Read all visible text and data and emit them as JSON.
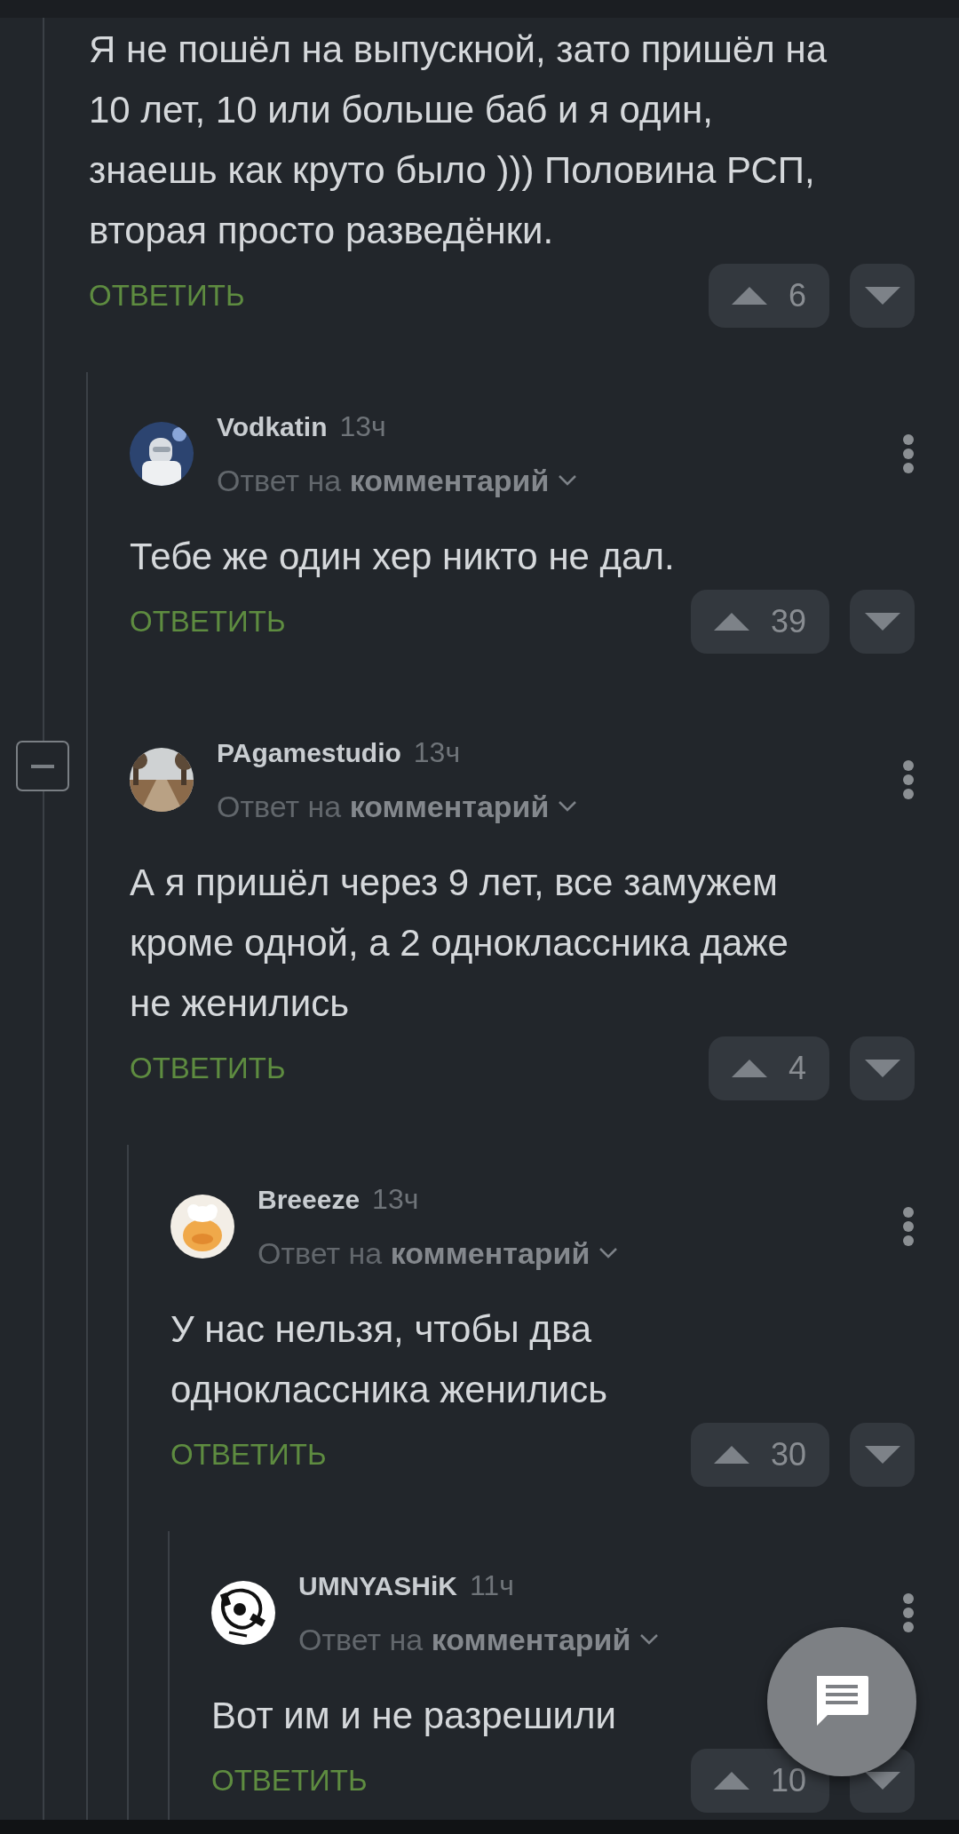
{
  "comments": [
    {
      "text": "Я не пошёл на выпускной, зато пришёл на 10 лет, 10 или больше баб и я один, знаешь как круто было ))) Половина РСП, вторая просто разведёнки.",
      "reply_label": "ОТВЕТИТЬ",
      "votes": "6",
      "replies": [
        {
          "author": "Vodkatin",
          "time": "13ч",
          "reply_to": "Ответ на **комментарий**",
          "text": "Тебе же один хер никто не дал.",
          "reply_label": "ОТВЕТИТЬ",
          "votes": "39"
        },
        {
          "author": "PAgamestudio",
          "time": "13ч",
          "reply_to": "Ответ на **комментарий**",
          "collapse": {
            "expanded": true
          },
          "text": "А я пришёл через 9 лет, все замужем кроме одной, а 2 одноклассника даже не женились",
          "reply_label": "ОТВЕТИТЬ",
          "votes": "4",
          "replies": [
            {
              "author": "Breeeze",
              "time": "13ч",
              "reply_to": "Ответ на **комментарий**",
              "text": "У нас нельзя, чтобы два одноклассника женились",
              "reply_label": "ОТВЕТИТЬ",
              "votes": "30",
              "replies": [
                {
                  "author": "UMNYASHiK",
                  "time": "11ч",
                  "reply_to": "Ответ на **комментарий**",
                  "text": "Вот им и не разрешили",
                  "reply_label": "ОТВЕТИТЬ",
                  "votes": "10"
                }
              ]
            }
          ]
        }
      ]
    }
  ]
}
